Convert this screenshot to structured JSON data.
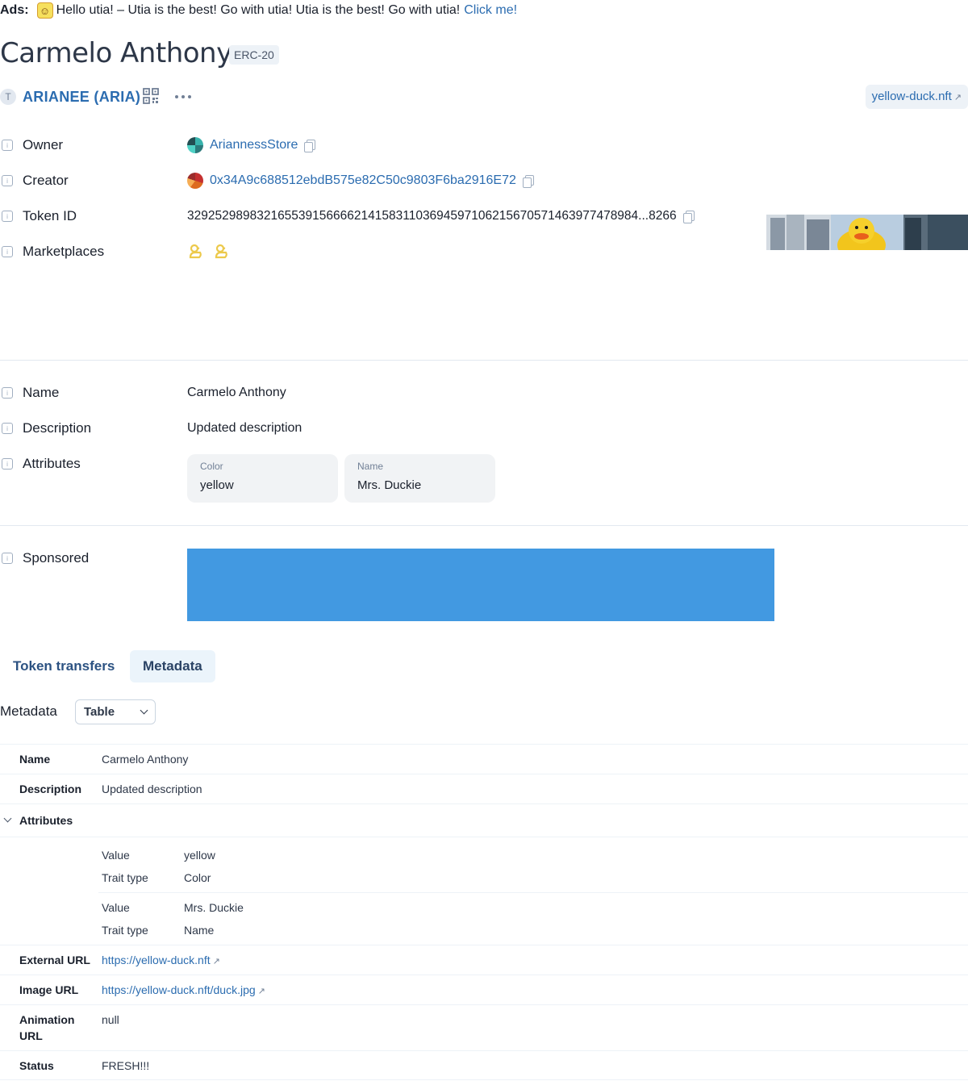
{
  "ads": {
    "label": "Ads:",
    "text": "Hello utia! – Utia is the best! Go with utia! Utia is the best! Go with utia!",
    "link": "Click me!",
    "icon": "duck-emoji-icon"
  },
  "header": {
    "title": "Carmelo Anthony",
    "badge": "ERC-20",
    "token_avatar": "T",
    "token_name": "ARIANEE (ARIA)",
    "domain": "yellow-duck.nft"
  },
  "details": {
    "owner_label": "Owner",
    "owner_value": "AriannessStore",
    "creator_label": "Creator",
    "creator_value": "0x34A9c688512ebdB575e82C50c9803F6ba2916E72",
    "token_id_label": "Token ID",
    "token_id_value": "32925298983216553915666621415831103694597106215670571463977478984...8266",
    "marketplaces_label": "Marketplaces"
  },
  "metadata_fields": {
    "name_label": "Name",
    "name_value": "Carmelo Anthony",
    "description_label": "Description",
    "description_value": "Updated description",
    "attributes_label": "Attributes",
    "attributes": [
      {
        "key": "Color",
        "value": "yellow"
      },
      {
        "key": "Name",
        "value": "Mrs. Duckie"
      }
    ],
    "sponsored_label": "Sponsored"
  },
  "tabs": [
    {
      "label": "Token transfers",
      "active": false
    },
    {
      "label": "Metadata",
      "active": true
    }
  ],
  "metadata_view": {
    "label": "Metadata",
    "select_value": "Table"
  },
  "metadata_table": {
    "name_key": "Name",
    "name_value": "Carmelo Anthony",
    "description_key": "Description",
    "description_value": "Updated description",
    "attributes_key": "Attributes",
    "attr_items": [
      {
        "value_k": "Value",
        "value_v": "yellow",
        "trait_k": "Trait type",
        "trait_v": "Color"
      },
      {
        "value_k": "Value",
        "value_v": "Mrs. Duckie",
        "trait_k": "Trait type",
        "trait_v": "Name"
      }
    ],
    "external_url_key": "External URL",
    "external_url_value": "https://yellow-duck.nft",
    "image_url_key": "Image URL",
    "image_url_value": "https://yellow-duck.nft/duck.jpg",
    "animation_url_key_1": "Animation",
    "animation_url_key_2": "URL",
    "animation_url_value": "null",
    "status_key": "Status",
    "status_value": "FRESH!!!"
  },
  "colors": {
    "link": "#2b6cb0",
    "banner": "#4299e1",
    "tab_active_bg": "#ebf4fb"
  }
}
